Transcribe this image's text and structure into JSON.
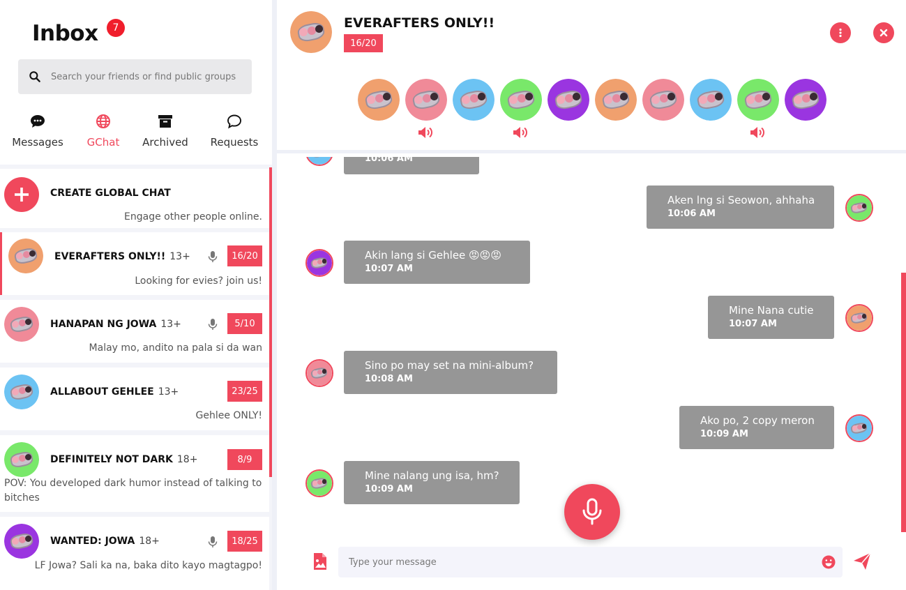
{
  "sidebar": {
    "title": "Inbox",
    "badge": "7",
    "search_placeholder": "Search your friends or find public groups",
    "tabs": [
      {
        "label": "Messages",
        "icon": "chat-bubble-dots-icon",
        "active": false
      },
      {
        "label": "GChat",
        "icon": "globe-icon",
        "active": true
      },
      {
        "label": "Archived",
        "icon": "archive-box-icon",
        "active": false
      },
      {
        "label": "Requests",
        "icon": "chat-bubble-outline-icon",
        "active": false
      }
    ],
    "create": {
      "title": "CREATE GLOBAL CHAT",
      "subtitle": "Engage other people online."
    },
    "chats": [
      {
        "name": "EVERAFTERS ONLY!!",
        "age": "13+",
        "count": "16/20",
        "desc": "Looking for evies? join us!",
        "voice": true,
        "color": "#f0a06e"
      },
      {
        "name": "HANAPAN NG JOWA",
        "age": "13+",
        "count": "5/10",
        "desc": "Malay mo, andito na pala si da wan",
        "voice": true,
        "color": "#f08a98"
      },
      {
        "name": "ALLABOUT GEHLEE",
        "age": "13+",
        "count": "23/25",
        "desc": "Gehlee ONLY!",
        "voice": false,
        "color": "#6cc3f3"
      },
      {
        "name": "DEFINITELY NOT DARK",
        "age": "18+",
        "count": "8/9",
        "desc": "POV: You developed dark humor instead of talking to bitches",
        "voice": false,
        "color": "#79e86a"
      },
      {
        "name": "WANTED: JOWA",
        "age": "18+",
        "count": "18/25",
        "desc": "LF Jowa? Sali ka na, baka dito kayo magtagpo!",
        "voice": true,
        "color": "#9a35e0"
      }
    ]
  },
  "header": {
    "title": "EVERAFTERS ONLY!!",
    "count": "16/20",
    "members": [
      {
        "color": "#f0a06e",
        "speaking": false
      },
      {
        "color": "#f08a98",
        "speaking": true
      },
      {
        "color": "#6cc3f3",
        "speaking": false
      },
      {
        "color": "#79e86a",
        "speaking": true
      },
      {
        "color": "#9a35e0",
        "speaking": false
      },
      {
        "color": "#f0a06e",
        "speaking": false
      },
      {
        "color": "#f08a98",
        "speaking": false
      },
      {
        "color": "#6cc3f3",
        "speaking": false
      },
      {
        "color": "#79e86a",
        "speaking": true
      },
      {
        "color": "#9a35e0",
        "speaking": false
      }
    ]
  },
  "messages": [
    {
      "side": "left",
      "text": "",
      "time": "10:06 AM",
      "color": "#6cc3f3"
    },
    {
      "side": "right",
      "text": "Aken lng si Seowon, ahhaha",
      "time": "10:06 AM",
      "color": "#79e86a"
    },
    {
      "side": "left",
      "text": "Akin lang si Gehlee 😡😡😡",
      "time": "10:07 AM",
      "color": "#9a35e0"
    },
    {
      "side": "right",
      "text": "Mine Nana cutie",
      "time": "10:07 AM",
      "color": "#f0a06e"
    },
    {
      "side": "left",
      "text": "Sino po may set na mini-album?",
      "time": "10:08 AM",
      "color": "#f08a98"
    },
    {
      "side": "right",
      "text": "Ako po, 2 copy meron",
      "time": "10:09 AM",
      "color": "#6cc3f3"
    },
    {
      "side": "left",
      "text": "Mine nalang ung isa, hm?",
      "time": "10:09 AM",
      "color": "#79e86a"
    }
  ],
  "composer": {
    "placeholder": "Type your message"
  },
  "accent": "#f0485c"
}
